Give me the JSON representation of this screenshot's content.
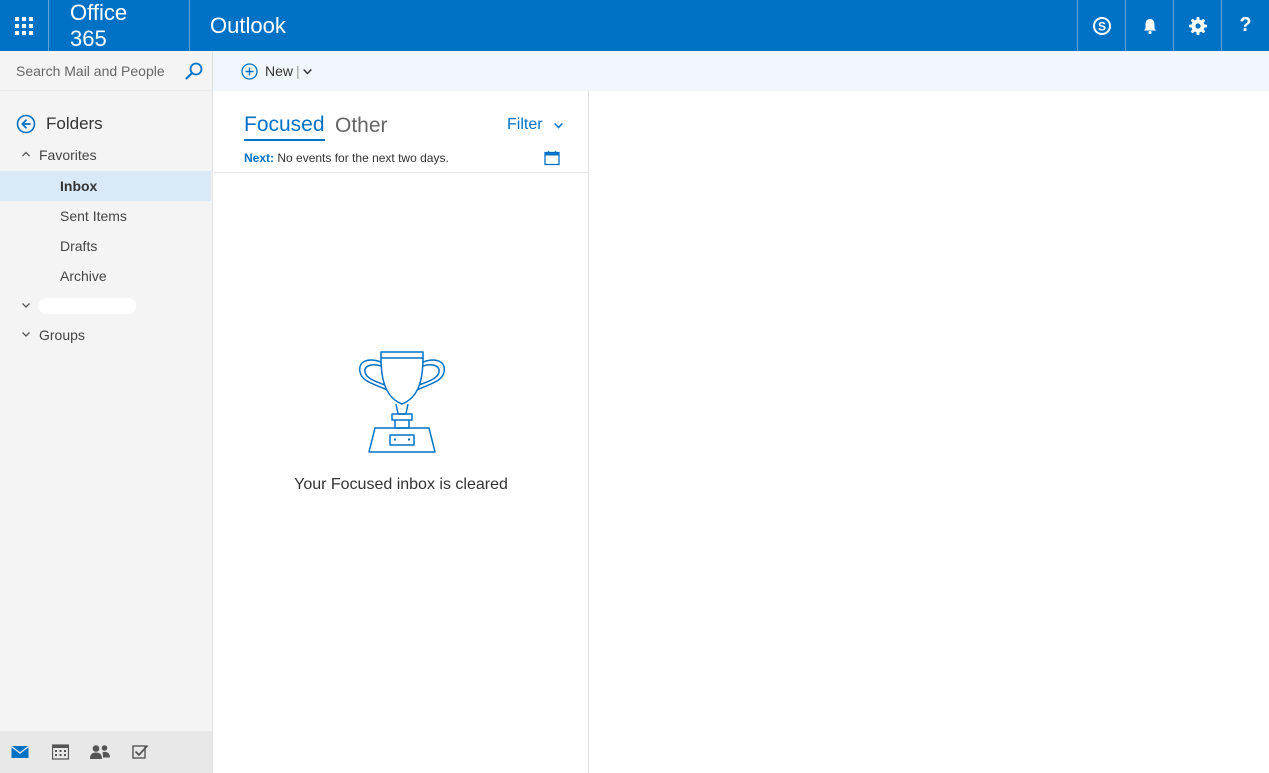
{
  "topbar": {
    "suite_name": "Office 365",
    "app_name": "Outlook",
    "accent_color": "#0072c6",
    "icons": [
      "app-launcher-icon",
      "skype-icon",
      "bell-icon",
      "gear-icon",
      "help-icon"
    ],
    "help_glyph": "?"
  },
  "search": {
    "placeholder": "Search Mail and People"
  },
  "leftnav": {
    "folders_header": "Folders",
    "favorites_label": "Favorites",
    "favorites": [
      {
        "label": "Inbox",
        "selected": true
      },
      {
        "label": "Sent Items",
        "selected": false
      },
      {
        "label": "Drafts",
        "selected": false
      },
      {
        "label": "Archive",
        "selected": false
      }
    ],
    "groups_label": "Groups",
    "bottom_icons": [
      "mail-icon",
      "calendar-icon",
      "people-icon",
      "tasks-icon"
    ]
  },
  "commandbar": {
    "new_label": "New"
  },
  "msglist": {
    "tab_focused": "Focused",
    "tab_other": "Other",
    "filter_label": "Filter",
    "next_label": "Next:",
    "next_text": "No events for the next two days.",
    "empty_message": "Your Focused inbox is cleared"
  }
}
